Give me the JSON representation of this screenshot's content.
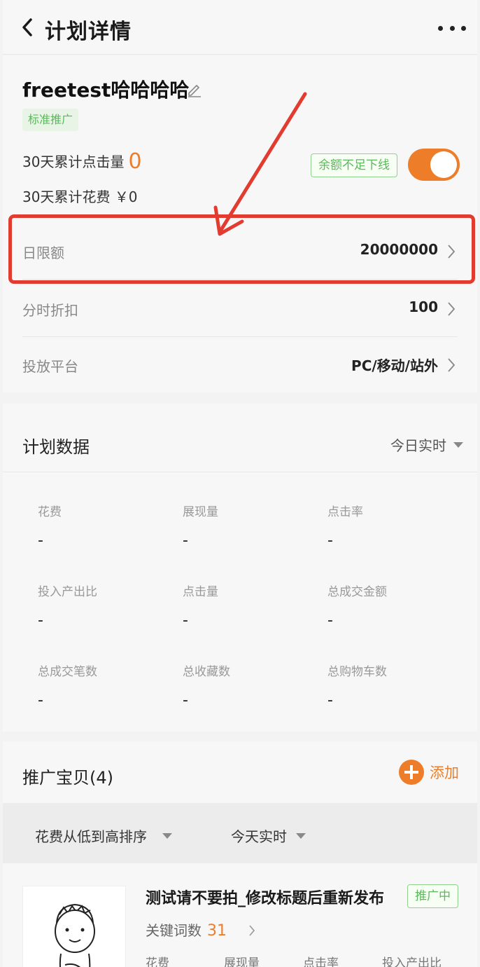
{
  "nav": {
    "title": "计划详情"
  },
  "plan": {
    "name": "freetest哈哈哈哈",
    "type_tag": "标准推广",
    "clicks_label": "30天累计点击量",
    "clicks_value": "0",
    "cost_label": "30天累计花费",
    "cost_value": "￥0",
    "status_badge": "余额不足下线",
    "toggle_on": true,
    "rows": [
      {
        "label": "日限额",
        "value": "20000000"
      },
      {
        "label": "分时折扣",
        "value": "100"
      },
      {
        "label": "投放平台",
        "value": "PC/移动/站外"
      }
    ]
  },
  "plan_data": {
    "title": "计划数据",
    "range": "今日实时",
    "metrics": [
      {
        "label": "花费",
        "value": "-"
      },
      {
        "label": "展现量",
        "value": "-"
      },
      {
        "label": "点击率",
        "value": "-"
      },
      {
        "label": "投入产出比",
        "value": "-"
      },
      {
        "label": "点击量",
        "value": "-"
      },
      {
        "label": "总成交金额",
        "value": "-"
      },
      {
        "label": "总成交笔数",
        "value": "-"
      },
      {
        "label": "总收藏数",
        "value": "-"
      },
      {
        "label": "总购物车数",
        "value": "-"
      }
    ]
  },
  "items": {
    "title": "推广宝贝(4)",
    "add_label": "添加",
    "sort_label": "花费从低到高排序",
    "range_label": "今天实时",
    "first": {
      "title": "测试请不要拍_修改标题后重新发布",
      "status": "推广中",
      "keyword_label": "关键词数",
      "keyword_count": "31",
      "metrics": [
        "花费",
        "展现量",
        "点击率",
        "投入产出比"
      ]
    }
  },
  "colors": {
    "accent": "#ee7d2a",
    "green": "#5cb85c",
    "annotation": "#e23b2f"
  }
}
